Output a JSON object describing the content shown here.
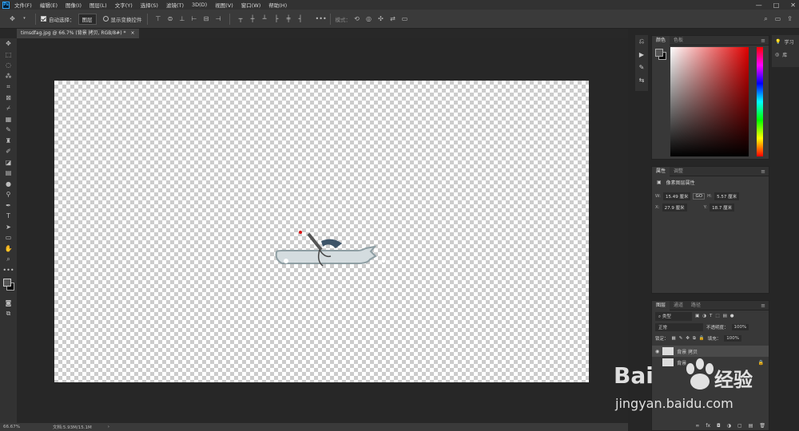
{
  "menubar": {
    "app_icon": "Ps",
    "items": [
      "文件(F)",
      "编辑(E)",
      "图像(I)",
      "图层(L)",
      "文字(Y)",
      "选择(S)",
      "滤镜(T)",
      "3D(D)",
      "视图(V)",
      "窗口(W)",
      "帮助(H)"
    ],
    "controls": [
      "—",
      "□",
      "✕"
    ]
  },
  "options": {
    "auto_select_label": "自动选择：",
    "auto_select_value": "图层",
    "show_transform_label": "显示变换控件",
    "mode_label": "模式："
  },
  "document": {
    "tab_title": "timsdfag.jpg @ 66.7% (背景 拷贝, RGB/8#) *",
    "tab_close": "×"
  },
  "status": {
    "zoom": "66.67%",
    "doc_info": "文档:5.93M/15.1M",
    "arrow": "›"
  },
  "color_panel": {
    "tabs": [
      "颜色",
      "色板"
    ],
    "fg_color": "#555555",
    "bg_color": "#000000",
    "hue_color": "#e00000"
  },
  "properties_panel": {
    "tabs": [
      "属性",
      "调整"
    ],
    "layer_kind": "像素图层属性",
    "w_label": "W:",
    "w_value": "15.49 厘米",
    "link_label": "GO",
    "h_label": "H:",
    "h_value": "5.57 厘米",
    "x_label": "X:",
    "x_value": "27.9 厘米",
    "y_label": "Y:",
    "y_value": "18.7 厘米"
  },
  "layers_panel": {
    "tabs": [
      "图层",
      "通道",
      "路径"
    ],
    "filter_value": "类型",
    "blend_mode": "正常",
    "opacity_label": "不透明度：",
    "opacity_value": "100%",
    "lock_label": "锁定：",
    "fill_label": "填充：",
    "fill_value": "100%",
    "layers": [
      {
        "name": "背景 拷贝"
      },
      {
        "name": "背景"
      }
    ],
    "bottom_icons": [
      "∞",
      "fx",
      "◘",
      "◑",
      "▢",
      "▤",
      "🗑"
    ]
  },
  "right_strip": {
    "items": [
      {
        "icon": "bulb-icon",
        "label": "学习"
      },
      {
        "icon": "library-icon",
        "label": "库"
      }
    ]
  },
  "watermark": {
    "brand": "Bai",
    "brand_cn": "经验",
    "url": "jingyan.baidu.com"
  }
}
